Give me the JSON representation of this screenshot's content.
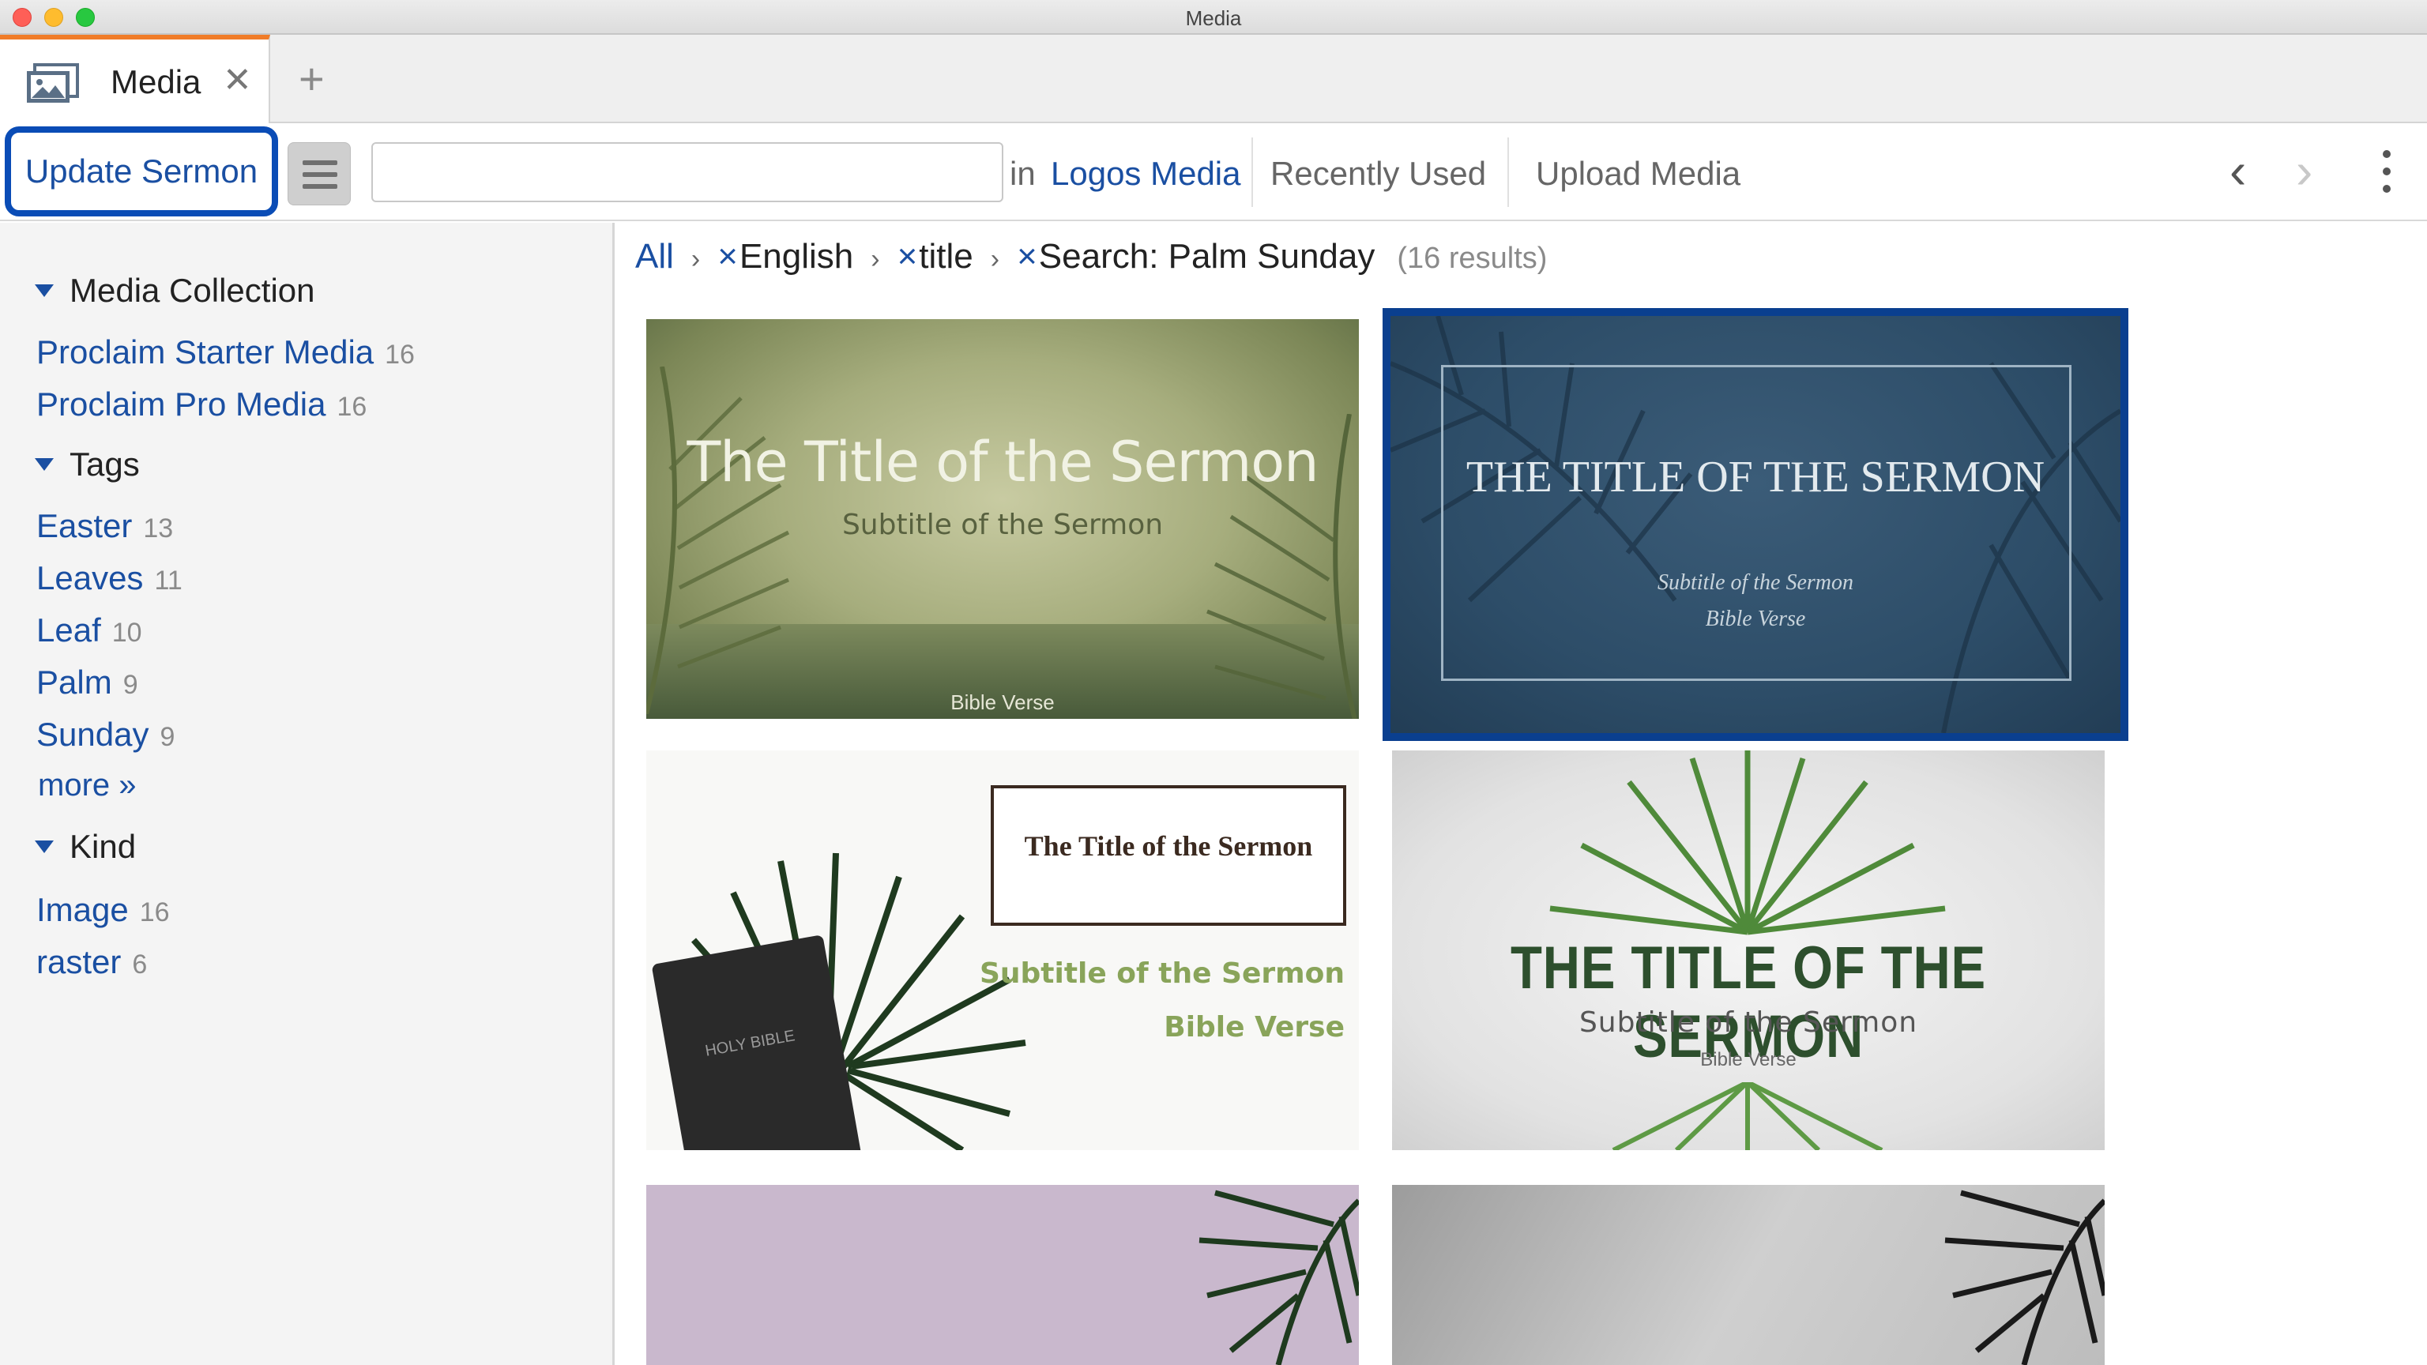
{
  "window": {
    "title": "Media"
  },
  "tab": {
    "label": "Media",
    "close": "✕",
    "add": "+"
  },
  "toolbar": {
    "update_button": "Update Sermon",
    "search_value": "",
    "in_label": "in",
    "scope": "Logos Media",
    "recently_used": "Recently Used",
    "upload_media": "Upload Media",
    "back": "‹",
    "forward": "›"
  },
  "sidebar": {
    "media_collection": {
      "heading": "Media Collection",
      "items": [
        {
          "label": "Proclaim Starter Media",
          "count": "16"
        },
        {
          "label": "Proclaim Pro Media",
          "count": "16"
        }
      ]
    },
    "tags": {
      "heading": "Tags",
      "items": [
        {
          "label": "Easter",
          "count": "13"
        },
        {
          "label": "Leaves",
          "count": "11"
        },
        {
          "label": "Leaf",
          "count": "10"
        },
        {
          "label": "Palm",
          "count": "9"
        },
        {
          "label": "Sunday",
          "count": "9"
        }
      ],
      "more": "more »"
    },
    "kind": {
      "heading": "Kind",
      "items": [
        {
          "label": "Image",
          "count": "16"
        },
        {
          "label": "raster",
          "count": "6"
        }
      ]
    }
  },
  "breadcrumb": {
    "all": "All",
    "sep": "›",
    "remove": "×",
    "filters": [
      "English",
      "title",
      "Search: Palm Sunday"
    ],
    "results": "(16 results)"
  },
  "thumbnails": [
    {
      "title": "The Title of the Sermon",
      "subtitle": "Subtitle of the Sermon",
      "verse": "Bible Verse"
    },
    {
      "title": "THE TITLE OF THE SERMON",
      "subtitle": "Subtitle of the Sermon",
      "verse": "Bible Verse"
    },
    {
      "title": "The Title of the Sermon",
      "subtitle": "Subtitle of the Sermon",
      "verse": "Bible Verse",
      "book": "HOLY BIBLE"
    },
    {
      "title": "THE TITLE OF THE SERMON",
      "subtitle": "Subtitle of the Sermon",
      "verse": "Bible Verse"
    }
  ],
  "colors": {
    "accent": "#1a4fa2",
    "tab_highlight": "#f07c28",
    "selection": "#0a3f8f"
  },
  "icons": [
    "media-tab-icon",
    "close-icon",
    "plus-icon",
    "hamburger-icon",
    "back-arrow-icon",
    "forward-arrow-icon",
    "more-vertical-icon",
    "caret-down-icon",
    "palm-leaf-icon"
  ]
}
